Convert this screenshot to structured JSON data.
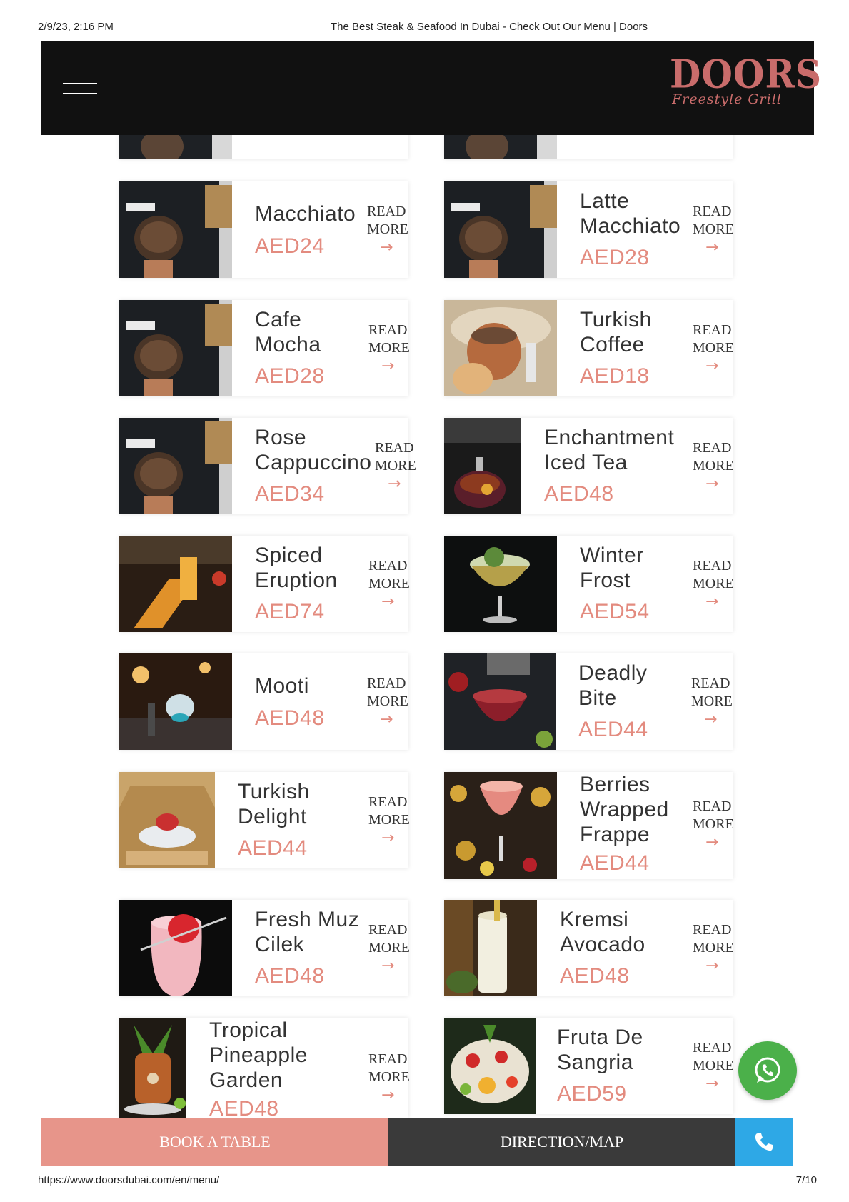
{
  "print_header": {
    "datetime": "2/9/23, 2:16 PM",
    "title": "The Best Steak & Seafood In Dubai - Check Out Our Menu | Doors"
  },
  "print_footer": {
    "url": "https://www.doorsdubai.com/en/menu/",
    "page": "7/10"
  },
  "header": {
    "logo_main": "DOORS",
    "logo_sub": "Freestyle Grill"
  },
  "read_more": {
    "line1": "READ",
    "line2": "MORE",
    "arrow": "→"
  },
  "menu": [
    {
      "name": "Macchiato",
      "price": "AED24"
    },
    {
      "name": "Latte\nMacchiato",
      "price": "AED28"
    },
    {
      "name": "Cafe\nMocha",
      "price": "AED28"
    },
    {
      "name": "Turkish\nCoffee",
      "price": "AED18"
    },
    {
      "name": "Rose\nCappuccino",
      "price": "AED34"
    },
    {
      "name": "Enchantment\nIced Tea",
      "price": "AED48"
    },
    {
      "name": "Spiced\nEruption",
      "price": "AED74"
    },
    {
      "name": "Winter\nFrost",
      "price": "AED54"
    },
    {
      "name": "Mooti",
      "price": "AED48"
    },
    {
      "name": "Deadly\nBite",
      "price": "AED44"
    },
    {
      "name": "Turkish\nDelight",
      "price": "AED44"
    },
    {
      "name": "Berries\nWrapped\nFrappe",
      "price": "AED44"
    },
    {
      "name": "Fresh Muz\nCilek",
      "price": "AED48"
    },
    {
      "name": "Kremsi\nAvocado",
      "price": "AED48"
    },
    {
      "name": "Tropical\nPineapple\nGarden",
      "price": "AED48"
    },
    {
      "name": "Fruta De\nSangria",
      "price": "AED59"
    }
  ],
  "bottom_bar": {
    "book_label": "BOOK A TABLE",
    "map_label": "DIRECTION/MAP",
    "call_icon": "phone-icon"
  },
  "floating": {
    "whatsapp_icon": "whatsapp-icon"
  },
  "colors": {
    "accent": "#e38b7f",
    "header_bg": "#111111",
    "book_bg": "#e7958a",
    "map_bg": "#3a3a3a",
    "call_bg": "#2ea8e6",
    "whatsapp_bg": "#4bb04a"
  }
}
